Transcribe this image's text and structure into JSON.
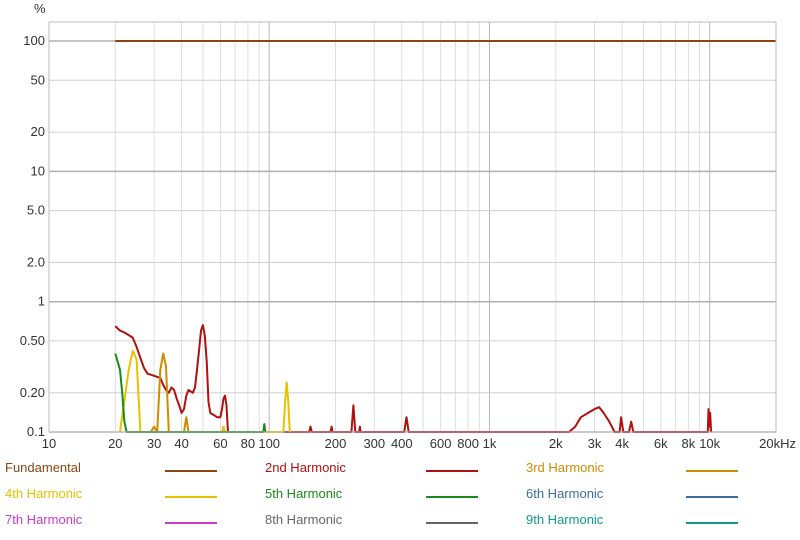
{
  "chart_data": {
    "type": "line",
    "y_unit_label": "%",
    "x_scale": "log",
    "y_scale": "log",
    "xlim": [
      10,
      20000
    ],
    "ylim": [
      0.1,
      140
    ],
    "grid": true,
    "legend_position": "bottom",
    "x_ticks": [
      {
        "v": 10,
        "label": "10"
      },
      {
        "v": 20,
        "label": "20"
      },
      {
        "v": 30,
        "label": "30"
      },
      {
        "v": 40,
        "label": "40"
      },
      {
        "v": 60,
        "label": "60"
      },
      {
        "v": 80,
        "label": "80"
      },
      {
        "v": 100,
        "label": "100"
      },
      {
        "v": 200,
        "label": "200"
      },
      {
        "v": 300,
        "label": "300"
      },
      {
        "v": 400,
        "label": "400"
      },
      {
        "v": 600,
        "label": "600"
      },
      {
        "v": 800,
        "label": "800"
      },
      {
        "v": 1000,
        "label": "1k"
      },
      {
        "v": 2000,
        "label": "2k"
      },
      {
        "v": 3000,
        "label": "3k"
      },
      {
        "v": 4000,
        "label": "4k"
      },
      {
        "v": 6000,
        "label": "6k"
      },
      {
        "v": 8000,
        "label": "8k"
      },
      {
        "v": 10000,
        "label": "10k"
      },
      {
        "v": 20000,
        "label": "20kHz"
      }
    ],
    "y_ticks": [
      {
        "v": 100,
        "label": "100"
      },
      {
        "v": 50,
        "label": "50"
      },
      {
        "v": 20,
        "label": "20"
      },
      {
        "v": 10,
        "label": "10"
      },
      {
        "v": 5,
        "label": "5.0"
      },
      {
        "v": 2,
        "label": "2.0"
      },
      {
        "v": 1,
        "label": "1"
      },
      {
        "v": 0.5,
        "label": "0.50"
      },
      {
        "v": 0.2,
        "label": "0.20"
      },
      {
        "v": 0.1,
        "label": "0.1"
      }
    ],
    "series": [
      {
        "name": "Fundamental",
        "color": "#8b4513",
        "points": [
          [
            20,
            100
          ],
          [
            20000,
            100
          ]
        ]
      },
      {
        "name": "2nd Harmonic",
        "color": "#b01010",
        "points": [
          [
            20,
            0.65
          ],
          [
            21,
            0.6
          ],
          [
            22,
            0.58
          ],
          [
            24,
            0.53
          ],
          [
            25,
            0.45
          ],
          [
            26,
            0.37
          ],
          [
            27,
            0.31
          ],
          [
            28,
            0.28
          ],
          [
            30,
            0.27
          ],
          [
            32,
            0.26
          ],
          [
            33,
            0.23
          ],
          [
            34,
            0.21
          ],
          [
            35,
            0.2
          ],
          [
            36,
            0.22
          ],
          [
            37,
            0.21
          ],
          [
            38,
            0.18
          ],
          [
            39,
            0.16
          ],
          [
            40,
            0.14
          ],
          [
            41,
            0.15
          ],
          [
            42,
            0.19
          ],
          [
            43,
            0.21
          ],
          [
            45,
            0.2
          ],
          [
            46,
            0.22
          ],
          [
            47,
            0.3
          ],
          [
            48,
            0.42
          ],
          [
            49,
            0.6
          ],
          [
            50,
            0.66
          ],
          [
            51,
            0.55
          ],
          [
            52,
            0.35
          ],
          [
            53,
            0.17
          ],
          [
            54,
            0.14
          ],
          [
            56,
            0.135
          ],
          [
            58,
            0.13
          ],
          [
            60,
            0.13
          ],
          [
            61,
            0.15
          ],
          [
            62,
            0.18
          ],
          [
            63,
            0.19
          ],
          [
            64,
            0.16
          ],
          [
            65,
            0.1
          ],
          [
            70,
            0.1
          ],
          [
            152,
            0.1
          ],
          [
            154,
            0.11
          ],
          [
            156,
            0.1
          ],
          [
            190,
            0.1
          ],
          [
            192,
            0.11
          ],
          [
            194,
            0.1
          ],
          [
            236,
            0.1
          ],
          [
            241,
            0.16
          ],
          [
            246,
            0.1
          ],
          [
            256,
            0.1
          ],
          [
            258,
            0.11
          ],
          [
            260,
            0.1
          ],
          [
            410,
            0.1
          ],
          [
            420,
            0.13
          ],
          [
            430,
            0.1
          ],
          [
            2300,
            0.1
          ],
          [
            2450,
            0.11
          ],
          [
            2600,
            0.13
          ],
          [
            2800,
            0.14
          ],
          [
            3000,
            0.15
          ],
          [
            3150,
            0.155
          ],
          [
            3300,
            0.14
          ],
          [
            3500,
            0.12
          ],
          [
            3700,
            0.1
          ],
          [
            3900,
            0.1
          ],
          [
            3960,
            0.13
          ],
          [
            4050,
            0.1
          ],
          [
            4300,
            0.1
          ],
          [
            4400,
            0.12
          ],
          [
            4500,
            0.1
          ],
          [
            9800,
            0.1
          ],
          [
            9880,
            0.15
          ],
          [
            9960,
            0.11
          ],
          [
            10050,
            0.14
          ],
          [
            10150,
            0.1
          ]
        ]
      },
      {
        "name": "3rd Harmonic",
        "color": "#d08c00",
        "points": [
          [
            29,
            0.1
          ],
          [
            30,
            0.11
          ],
          [
            31,
            0.1
          ],
          [
            31,
            0.1
          ],
          [
            32,
            0.3
          ],
          [
            33,
            0.4
          ],
          [
            34,
            0.32
          ],
          [
            35,
            0.1
          ],
          [
            41,
            0.1
          ],
          [
            42,
            0.13
          ],
          [
            43,
            0.1
          ]
        ]
      },
      {
        "name": "4th Harmonic",
        "color": "#e5c200",
        "points": [
          [
            21,
            0.1
          ],
          [
            23,
            0.3
          ],
          [
            24,
            0.42
          ],
          [
            25,
            0.36
          ],
          [
            26,
            0.1
          ],
          [
            61,
            0.1
          ],
          [
            62,
            0.11
          ],
          [
            63,
            0.1
          ],
          [
            116,
            0.1
          ],
          [
            118,
            0.17
          ],
          [
            120,
            0.24
          ],
          [
            122,
            0.17
          ],
          [
            124,
            0.1
          ]
        ]
      },
      {
        "name": "5th Harmonic",
        "color": "#1a8a1a",
        "points": [
          [
            20,
            0.4
          ],
          [
            21,
            0.3
          ],
          [
            21.5,
            0.2
          ],
          [
            22,
            0.12
          ],
          [
            22.5,
            0.1
          ],
          [
            94,
            0.1
          ],
          [
            95,
            0.115
          ],
          [
            96,
            0.1
          ]
        ]
      },
      {
        "name": "6th Harmonic",
        "color": "#3c6ea0",
        "points": []
      },
      {
        "name": "7th Harmonic",
        "color": "#c83cc8",
        "points": []
      },
      {
        "name": "8th Harmonic",
        "color": "#666666",
        "points": []
      },
      {
        "name": "9th Harmonic",
        "color": "#119a8a",
        "points": []
      }
    ]
  }
}
